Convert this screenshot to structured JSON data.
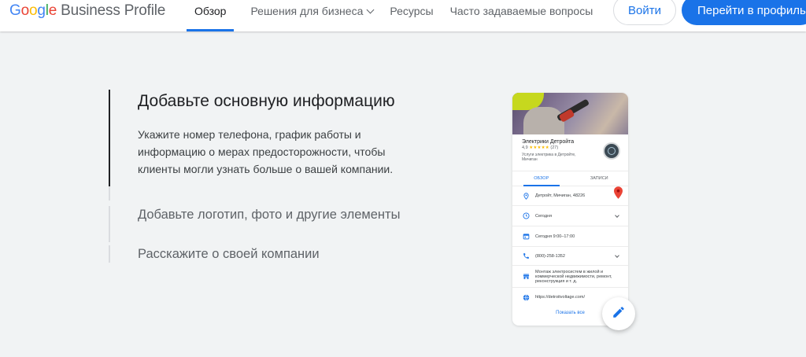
{
  "header": {
    "logo": {
      "g1": "G",
      "g2": "o",
      "g3": "o",
      "g4": "g",
      "g5": "l",
      "g6": "e",
      "product": "Business Profile"
    },
    "nav": [
      {
        "label": "Обзор"
      },
      {
        "label": "Решения для бизнеса"
      },
      {
        "label": "Ресурсы"
      },
      {
        "label": "Часто задаваемые вопросы"
      }
    ],
    "login_label": "Войти",
    "profile_label": "Перейти в профиль"
  },
  "steps": {
    "step1": {
      "title": "Добавьте основную информацию",
      "description": "Укажите номер телефона, график работы и информацию о мерах предосторожности, чтобы клиенты могли узнать больше о вашей компании."
    },
    "step2": {
      "title": "Добавьте логотип, фото и другие элементы"
    },
    "step3": {
      "title": "Расскажите о своей компании"
    }
  },
  "card": {
    "business_name": "Электрики Детройта",
    "rating": "4,9",
    "stars": "★★★★★",
    "reviews": "(27)",
    "category": "Услуги электрика в Детройте, Мичиган",
    "tabs": [
      {
        "label": "ОБЗОР"
      },
      {
        "label": "ЗАПИСИ"
      }
    ],
    "rows": {
      "address": "Детройт, Мичиган, 48226",
      "hours": "Сегодня",
      "hours_detail": "Сегодня 9:00–17:00",
      "phone": "(800)-258-1352",
      "services": "Монтаж электросистем в жилой и коммерческой недвижимости, ремонт, реконструкция и т. д.",
      "website": "https://detroitvoltage.com/"
    },
    "show_all": "Показать все"
  },
  "colors": {
    "accent": "#1a73e8",
    "background": "#f1f3f4",
    "pin": "#ea4335",
    "stars": "#fbbc04"
  },
  "icons": [
    "location-pin-icon",
    "clock-icon",
    "calendar-icon",
    "phone-icon",
    "store-icon",
    "globe-icon",
    "map-pin-icon",
    "edit-pencil-icon",
    "chevron-down-icon"
  ]
}
